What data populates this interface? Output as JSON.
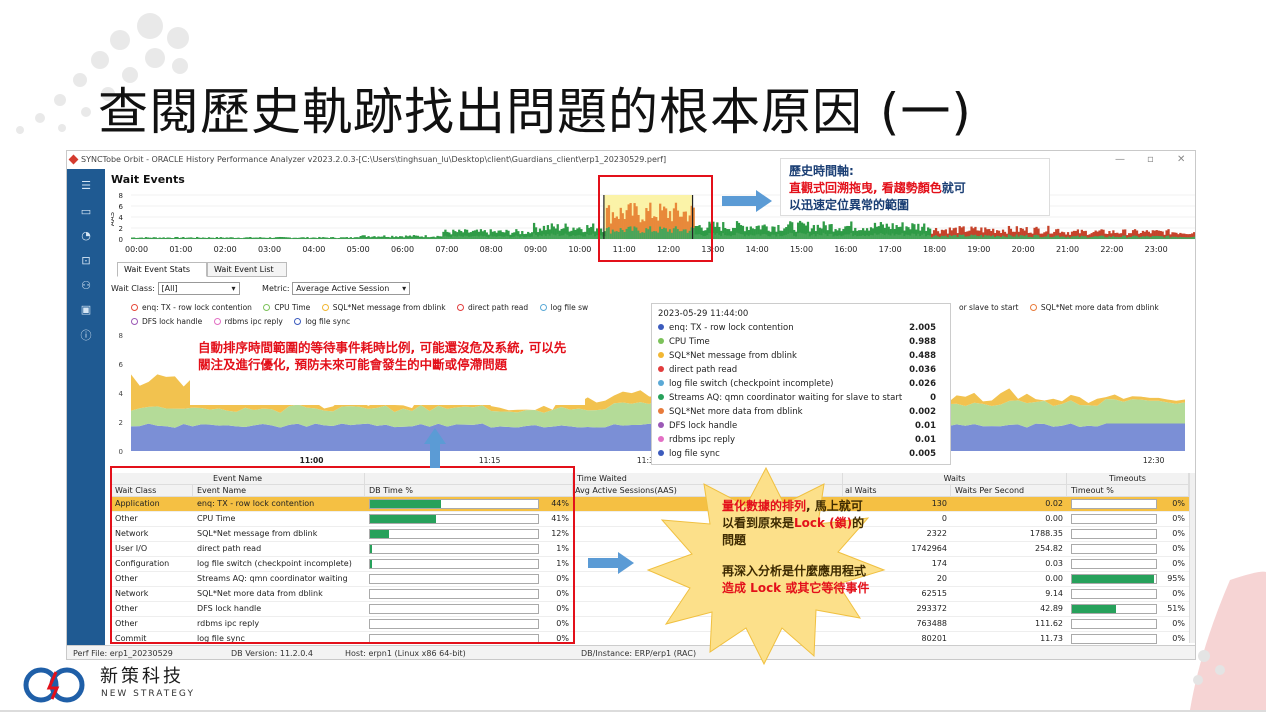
{
  "slide": {
    "title": "查閱歷史軌跡找出問題的根本原因 (一)",
    "brand_name": "新策科技",
    "brand_sub": "NEW STRATEGY"
  },
  "app": {
    "window_title": "SYNCTobe Orbit - ORACLE History Performance Analyzer v2023.2.0.3-[C:\\Users\\tinghsuan_lu\\Desktop\\client\\Guardians_client\\erp1_20230529.perf]",
    "section_title": "Wait Events",
    "timeline": {
      "y_label": "AAS",
      "y_ticks": [
        "8",
        "6",
        "4",
        "2",
        "0"
      ],
      "x_ticks": [
        "00:00",
        "01:00",
        "02:00",
        "03:00",
        "04:00",
        "05:00",
        "06:00",
        "07:00",
        "08:00",
        "09:00",
        "10:00",
        "11:00",
        "12:00",
        "13:00",
        "14:00",
        "15:00",
        "16:00",
        "17:00",
        "18:00",
        "19:00",
        "20:00",
        "21:00",
        "22:00",
        "23:00"
      ],
      "highlight_range": [
        "10:40",
        "12:40"
      ]
    },
    "tabs": [
      {
        "label": "Wait Event Stats",
        "active": true
      },
      {
        "label": "Wait Event List",
        "active": false
      }
    ],
    "toolbar": {
      "wait_class_label": "Wait Class:",
      "wait_class_value": "[All]",
      "metric_label": "Metric:",
      "metric_value": "Average Active Session"
    },
    "legend": [
      {
        "label": "enq: TX - row lock contention",
        "color": "#e64a3b"
      },
      {
        "label": "CPU Time",
        "color": "#7cc25a"
      },
      {
        "label": "SQL*Net message from dblink",
        "color": "#f2b733"
      },
      {
        "label": "direct path read",
        "color": "#e23d3d"
      },
      {
        "label": "log file sw",
        "color": "#5aa9d6"
      },
      {
        "label": "or slave to start",
        "color": "#e87b3b"
      },
      {
        "label": "SQL*Net more data from dblink",
        "color": "#e87b3b"
      },
      {
        "label": "DFS lock handle",
        "color": "#9b59b6"
      },
      {
        "label": "rdbms ipc reply",
        "color": "#e36fc4"
      },
      {
        "label": "log file sync",
        "color": "#3c5bbd"
      }
    ],
    "area_chart": {
      "y_ticks": [
        "8",
        "6",
        "4",
        "2",
        "0"
      ],
      "x_ticks": [
        "11:00",
        "11:15",
        "11:30",
        "12:30"
      ]
    },
    "tooltip": {
      "timestamp": "2023-05-29 11:44:00",
      "rows": [
        {
          "label": "enq: TX - row lock contention",
          "value": "2.005",
          "color": "#3c5bbd"
        },
        {
          "label": "CPU Time",
          "value": "0.988",
          "color": "#7cc25a"
        },
        {
          "label": "SQL*Net message from dblink",
          "value": "0.488",
          "color": "#f2b733"
        },
        {
          "label": "direct path read",
          "value": "0.036",
          "color": "#e23d3d"
        },
        {
          "label": "log file switch (checkpoint incomplete)",
          "value": "0.026",
          "color": "#5aa9d6"
        },
        {
          "label": "Streams AQ: qmn coordinator waiting for slave to start",
          "value": "0",
          "color": "#27a15b"
        },
        {
          "label": "SQL*Net more data from dblink",
          "value": "0.002",
          "color": "#e87b3b"
        },
        {
          "label": "DFS lock handle",
          "value": "0.01",
          "color": "#9b59b6"
        },
        {
          "label": "rdbms ipc reply",
          "value": "0.01",
          "color": "#e36fc4"
        },
        {
          "label": "log file sync",
          "value": "0.005",
          "color": "#3c5bbd"
        }
      ]
    },
    "table": {
      "group_headers": {
        "event_name": "Event Name",
        "time_waited": "Time Waited",
        "waits": "Waits",
        "timeouts": "Timeouts"
      },
      "columns": {
        "wait_class": "Wait Class",
        "event_name": "Event Name",
        "db_time": "DB Time %",
        "aas": "Avg Active Sessions(AAS)",
        "total_waits": "al Waits",
        "waits_per_sec": "Waits Per Second",
        "timeout_pct": "Timeout %"
      },
      "rows": [
        {
          "wait_class": "Application",
          "event": "enq: TX - row lock contention",
          "db_time_pct": 44,
          "db_time_label": "44%",
          "total_waits": "130",
          "waits_per_sec": "0.02",
          "timeout_pct": 0,
          "timeout_label": "0%",
          "selected": true
        },
        {
          "wait_class": "Other",
          "event": "CPU Time",
          "db_time_pct": 41,
          "db_time_label": "41%",
          "total_waits": "0",
          "waits_per_sec": "0.00",
          "timeout_pct": 0,
          "timeout_label": "0%"
        },
        {
          "wait_class": "Network",
          "event": "SQL*Net message from dblink",
          "db_time_pct": 12,
          "db_time_label": "12%",
          "total_waits": "2322",
          "waits_per_sec": "1788.35",
          "timeout_pct": 0,
          "timeout_label": "0%"
        },
        {
          "wait_class": "User I/O",
          "event": "direct path read",
          "db_time_pct": 1,
          "db_time_label": "1%",
          "total_waits": "1742964",
          "waits_per_sec": "254.82",
          "timeout_pct": 0,
          "timeout_label": "0%"
        },
        {
          "wait_class": "Configuration",
          "event": "log file switch (checkpoint incomplete)",
          "db_time_pct": 1,
          "db_time_label": "1%",
          "total_waits": "174",
          "waits_per_sec": "0.03",
          "timeout_pct": 0,
          "timeout_label": "0%"
        },
        {
          "wait_class": "Other",
          "event": "Streams AQ: qmn coordinator waiting",
          "db_time_pct": 0,
          "db_time_label": "0%",
          "total_waits": "20",
          "waits_per_sec": "0.00",
          "timeout_pct": 95,
          "timeout_label": "95%"
        },
        {
          "wait_class": "Network",
          "event": "SQL*Net more data from dblink",
          "db_time_pct": 0,
          "db_time_label": "0%",
          "total_waits": "62515",
          "waits_per_sec": "9.14",
          "timeout_pct": 0,
          "timeout_label": "0%"
        },
        {
          "wait_class": "Other",
          "event": "DFS lock handle",
          "db_time_pct": 0,
          "db_time_label": "0%",
          "total_waits": "293372",
          "waits_per_sec": "42.89",
          "timeout_pct": 51,
          "timeout_label": "51%"
        },
        {
          "wait_class": "Other",
          "event": "rdbms ipc reply",
          "db_time_pct": 0,
          "db_time_label": "0%",
          "total_waits": "763488",
          "waits_per_sec": "111.62",
          "timeout_pct": 0,
          "timeout_label": "0%"
        },
        {
          "wait_class": "Commit",
          "event": "log file sync",
          "db_time_pct": 0,
          "db_time_label": "0%",
          "total_waits": "80201",
          "waits_per_sec": "11.73",
          "timeout_pct": 0,
          "timeout_label": "0%"
        }
      ]
    },
    "statusbar": {
      "perf_file": "Perf File: erp1_20230529",
      "db_version": "DB Version: 11.2.0.4",
      "host": "Host: erpn1 (Linux x86 64-bit)",
      "instance": "DB/Instance: ERP/erp1 (RAC)"
    }
  },
  "callouts": {
    "timeline_title": "歷史時間軸:",
    "timeline_red": "直觀式回溯拖曳, 看趨勢顏色",
    "timeline_tail": "就可",
    "timeline_line2": "以迅速定位異常的範圍",
    "middle": "自動排序時間範圍的等待事件耗時比例, 可能還沒危及系統, 可以先關注及進行優化, 預防未來可能會發生的中斷或停滯問題",
    "burst_red1": "量化數據的排列",
    "burst_1": ", 馬上就可以看到原來是",
    "burst_red2": "Lock (鎖)",
    "burst_2": "的問題",
    "burst_3": "再深入分析是什麼應用程式",
    "burst_red3": "造成 Lock 或其它等待事件"
  }
}
